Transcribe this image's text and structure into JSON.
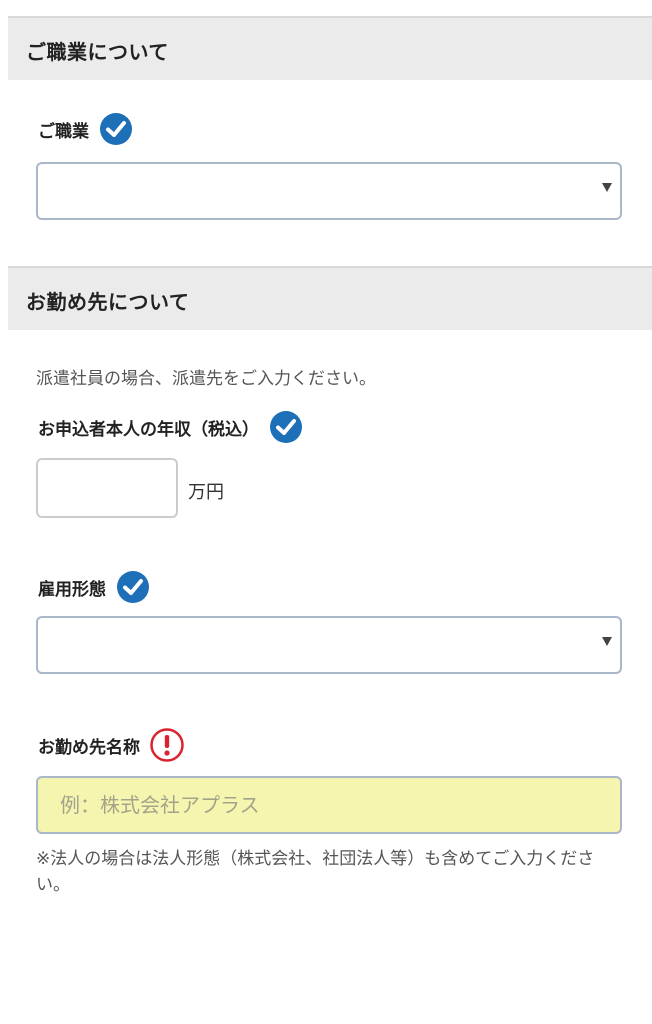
{
  "occupation_section": {
    "header": "ご職業について",
    "field_label": "ご職業",
    "select_value": ""
  },
  "employer_section": {
    "header": "お勤め先について",
    "note": "派遣社員の場合、派遣先をご入力ください。",
    "income_label": "お申込者本人の年収（税込）",
    "income_value": "",
    "income_unit": "万円",
    "employment_type_label": "雇用形態",
    "employment_type_value": "",
    "company_label": "お勤め先名称",
    "company_placeholder": "例：株式会社アプラス",
    "company_value": "",
    "footnote": "※法人の場合は法人形態（株式会社、社団法人等）も含めてご入力ください。"
  },
  "colors": {
    "check_blue": "#1d6fb8",
    "alert_red": "#d9232e",
    "header_bg": "#ebebeb",
    "required_field_bg": "#f5f5b0"
  }
}
